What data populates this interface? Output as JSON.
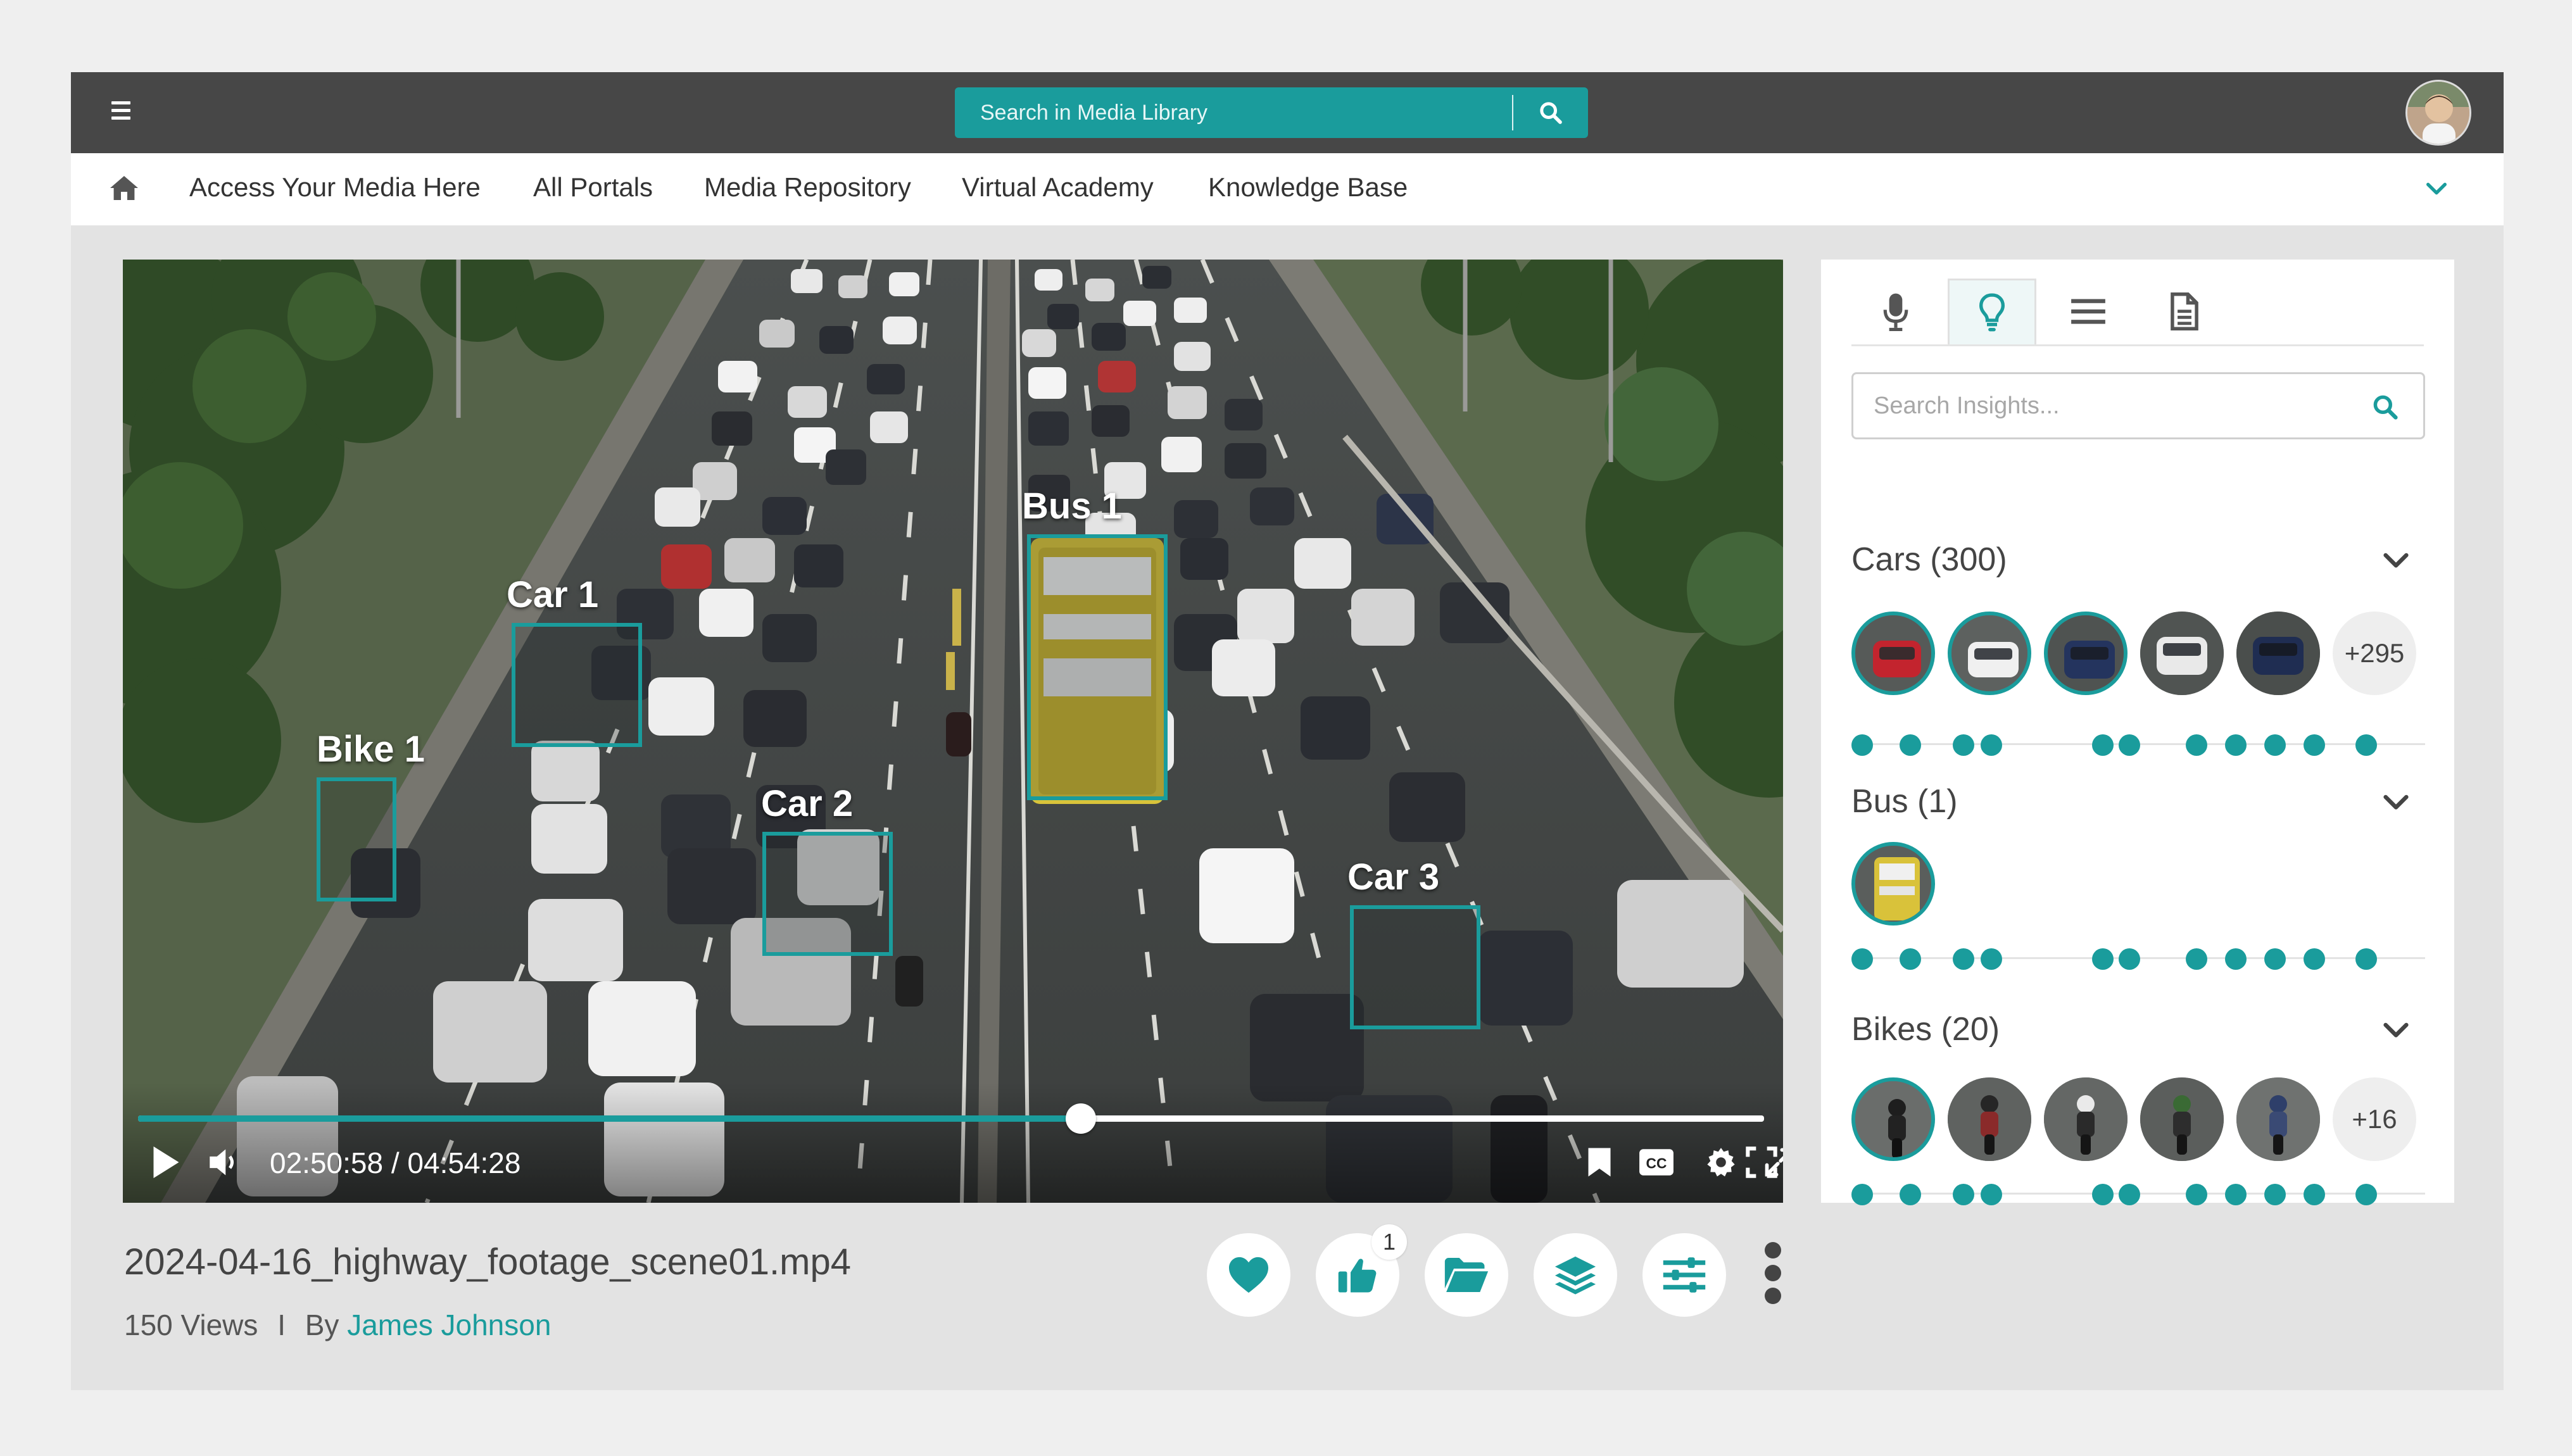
{
  "search": {
    "placeholder": "Search in Media Library"
  },
  "nav": {
    "items": [
      "Access Your Media Here",
      "All Portals",
      "Media Repository",
      "Virtual Academy",
      "Knowledge Base"
    ]
  },
  "video": {
    "boxes": [
      {
        "label": "Car 1"
      },
      {
        "label": "Car 2"
      },
      {
        "label": "Car 3"
      },
      {
        "label": "Bus 1"
      },
      {
        "label": "Bike 1"
      }
    ],
    "current_time": "02:50:58",
    "duration": "04:54:28",
    "time_display": "02:50:58 / 04:54:28",
    "progress_fraction": 0.58
  },
  "media": {
    "file_name": "2024-04-16_highway_footage_scene01.mp4",
    "views": "150 Views",
    "separator": "I",
    "by": "By",
    "author": "James Johnson",
    "like_count": "1"
  },
  "insights": {
    "search_placeholder": "Search Insights...",
    "groups": [
      {
        "title": "Cars (300)",
        "more": "+295"
      },
      {
        "title": "Bus (1)",
        "more": ""
      },
      {
        "title": "Bikes (20)",
        "more": "+16"
      }
    ]
  },
  "colors": {
    "accent": "#1a9c9c",
    "topbar": "#474747",
    "background": "#e3e3e3"
  },
  "icons": {
    "menu": "hamburger-icon",
    "search": "search-icon",
    "home": "home-icon",
    "expand": "chevron-down-icon",
    "tabs": [
      "microphone-icon",
      "lightbulb-icon",
      "list-icon",
      "document-icon"
    ],
    "actions": [
      "heart-icon",
      "thumbs-up-icon",
      "folder-icon",
      "layers-icon",
      "sliders-icon",
      "kebab-menu-icon"
    ],
    "player": [
      "play-icon",
      "volume-icon",
      "bookmark-icon",
      "cc-icon",
      "gear-icon",
      "expand-icon",
      "fullscreen-icon"
    ]
  }
}
